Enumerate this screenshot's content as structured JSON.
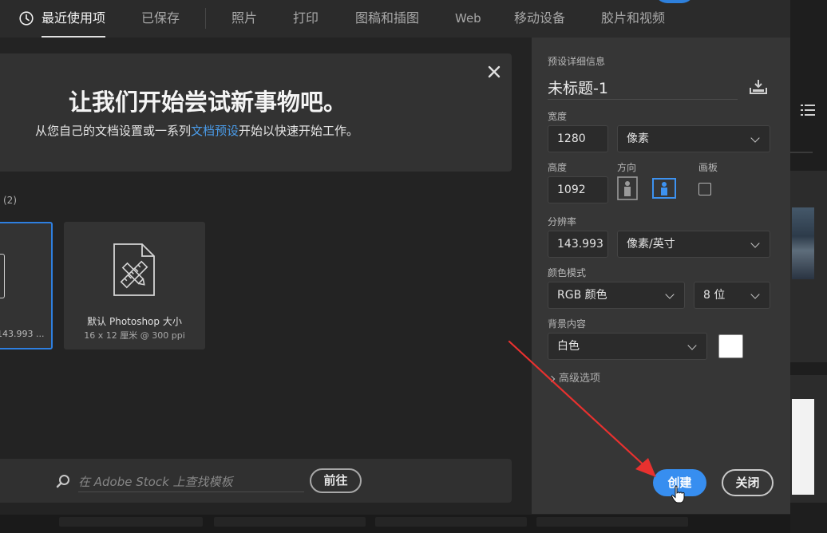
{
  "nav": {
    "items": [
      {
        "label": "最近使用项",
        "active": true
      },
      {
        "label": "已保存"
      },
      {
        "label": "照片"
      },
      {
        "label": "打印"
      },
      {
        "label": "图稿和插图"
      },
      {
        "label": "Web"
      },
      {
        "label": "移动设备"
      },
      {
        "label": "胶片和视频"
      }
    ]
  },
  "welcome": {
    "title": "让我们开始尝试新事物吧。",
    "subtitle_before": "从您自己的文档设置或一系列",
    "subtitle_link": "文档预设",
    "subtitle_after": "开始以快速开始工作。"
  },
  "recent": {
    "count_label": "(2)",
    "selected_card_caption": "143.993 ...",
    "default_card": {
      "name": "默认 Photoshop 大小",
      "meta": "16 x 12 厘米 @ 300 ppi"
    }
  },
  "stock": {
    "placeholder": "在 Adobe Stock 上查找模板",
    "go_label": "前往"
  },
  "preset": {
    "section_title": "预设详细信息",
    "doc_name": "未标题-1",
    "width_label": "宽度",
    "width_value": "1280",
    "width_unit": "像素",
    "height_label": "高度",
    "height_value": "1092",
    "orientation_label": "方向",
    "orientation_selected": "landscape",
    "artboard_label": "画板",
    "artboard_checked": false,
    "resolution_label": "分辨率",
    "resolution_value": "143.993",
    "resolution_unit": "像素/英寸",
    "color_mode_label": "颜色模式",
    "color_mode_value": "RGB 颜色",
    "bit_depth_value": "8 位",
    "background_label": "背景内容",
    "background_value": "白色",
    "background_color": "#ffffff",
    "advanced_label": "高级选项",
    "create_label": "创建",
    "close_label": "关闭"
  },
  "colors": {
    "accent": "#378ef0",
    "annotation_arrow": "#e8312f"
  }
}
